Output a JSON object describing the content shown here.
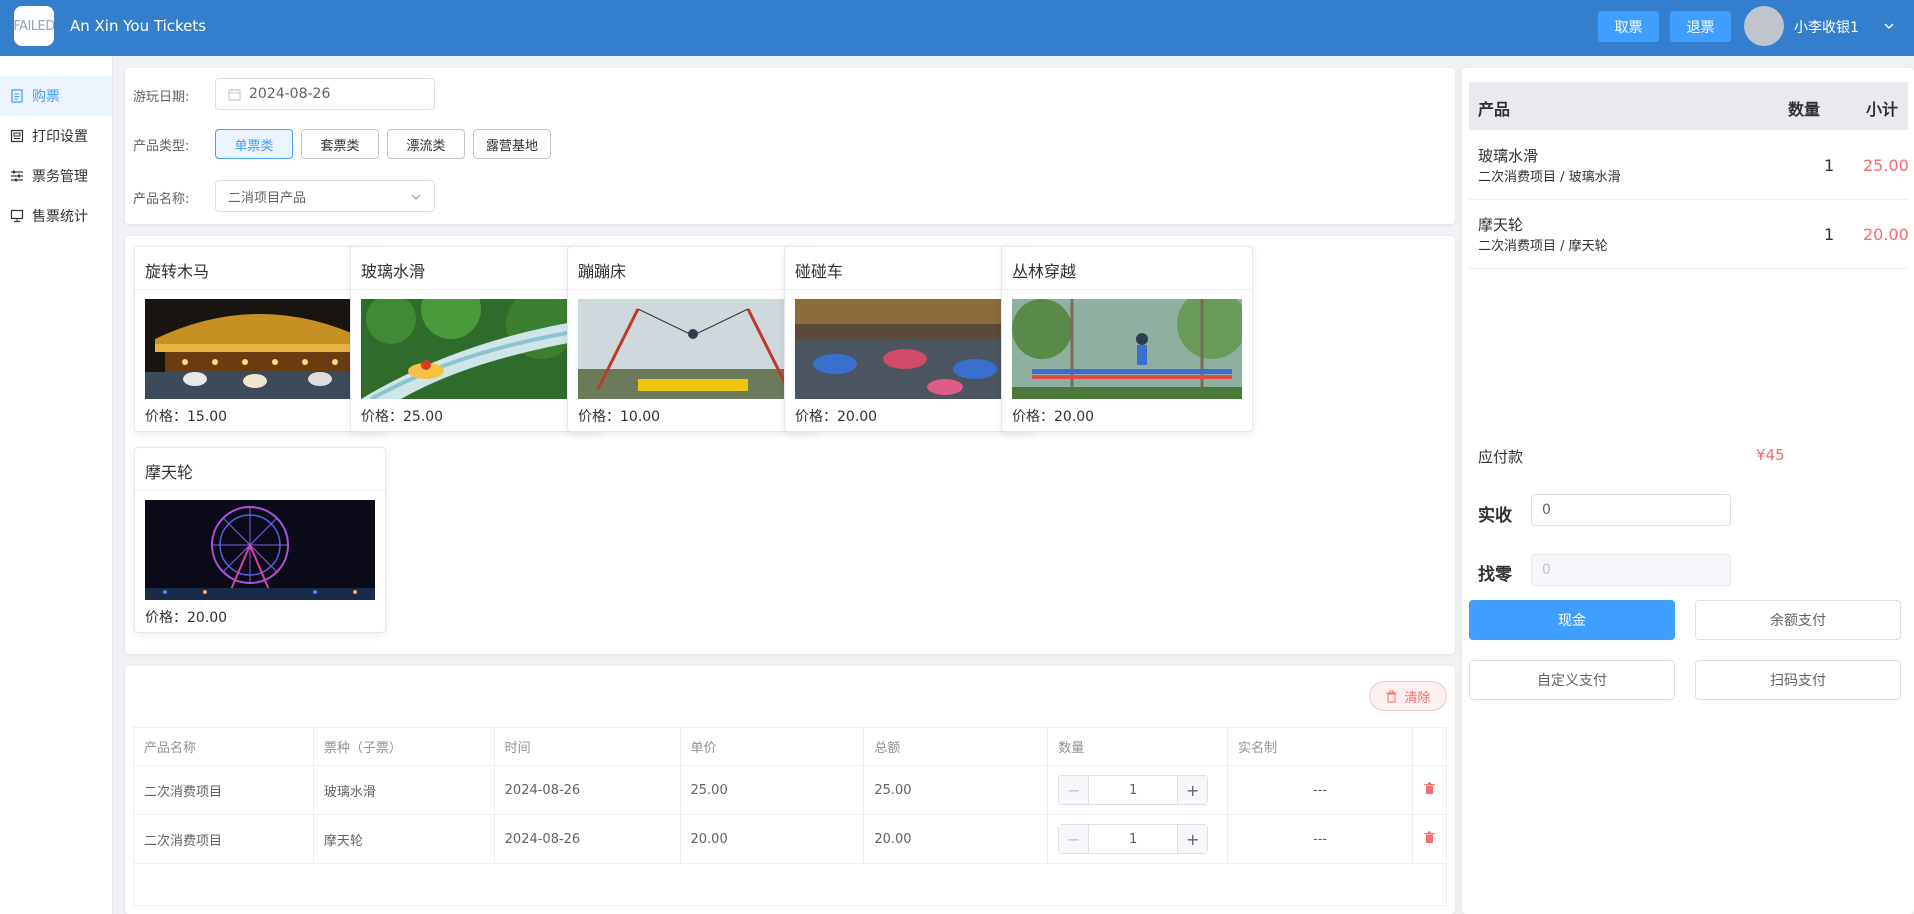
{
  "header": {
    "logo_text": "FAILED",
    "title": "An Xin You Tickets",
    "buttons": [
      "取票",
      "退票"
    ],
    "username": "小李收银1"
  },
  "sidebar": {
    "items": [
      {
        "label": "购票",
        "icon": "document-icon",
        "active": true
      },
      {
        "label": "打印设置",
        "icon": "printer-icon",
        "active": false
      },
      {
        "label": "票务管理",
        "icon": "sliders-icon",
        "active": false
      },
      {
        "label": "售票统计",
        "icon": "monitor-icon",
        "active": false
      }
    ]
  },
  "filter": {
    "date_label": "游玩日期:",
    "date_value": "2024-08-26",
    "type_label": "产品类型:",
    "types": [
      {
        "label": "单票类",
        "active": true
      },
      {
        "label": "套票类",
        "active": false
      },
      {
        "label": "漂流类",
        "active": false
      },
      {
        "label": "露营基地",
        "active": false
      }
    ],
    "name_label": "产品名称:",
    "name_value": "二消项目产品"
  },
  "products": [
    {
      "name": "旋转木马",
      "price": "价格：15.00",
      "scene": "carousel"
    },
    {
      "name": "玻璃水滑",
      "price": "价格：25.00",
      "scene": "slide"
    },
    {
      "name": "蹦蹦床",
      "price": "价格：10.00",
      "scene": "trampoline"
    },
    {
      "name": "碰碰车",
      "price": "价格：20.00",
      "scene": "bumper"
    },
    {
      "name": "丛林穿越",
      "price": "价格：20.00",
      "scene": "jungle"
    },
    {
      "name": "摩天轮",
      "price": "价格：20.00",
      "scene": "ferris"
    }
  ],
  "orders": {
    "clear_label": "清除",
    "headers": [
      "产品名称",
      "票种（子票）",
      "时间",
      "单价",
      "总额",
      "数量",
      "实名制",
      ""
    ],
    "rows": [
      {
        "product": "二次消费项目",
        "ticket": "玻璃水滑",
        "date": "2024-08-26",
        "unit": "25.00",
        "total": "25.00",
        "qty": "1",
        "realname": "---"
      },
      {
        "product": "二次消费项目",
        "ticket": "摩天轮",
        "date": "2024-08-26",
        "unit": "20.00",
        "total": "20.00",
        "qty": "1",
        "realname": "---"
      }
    ]
  },
  "cart": {
    "headers": {
      "product": "产品",
      "qty": "数量",
      "subtotal": "小计"
    },
    "items": [
      {
        "name": "玻璃水滑",
        "sub": "二次消费项目 / 玻璃水滑",
        "qty": "1",
        "subtotal": "25.00"
      },
      {
        "name": "摩天轮",
        "sub": "二次消费项目 / 摩天轮",
        "qty": "1",
        "subtotal": "20.00"
      }
    ],
    "due_label": "应付款",
    "due_amount": "¥45",
    "received_label": "实收",
    "received_value": "0",
    "change_label": "找零",
    "change_value": "0",
    "pay_buttons": [
      "现金",
      "余额支付",
      "自定义支付",
      "扫码支付"
    ]
  },
  "colors": {
    "header": "#337fce",
    "primary": "#409eff",
    "danger": "#f56c6c"
  }
}
